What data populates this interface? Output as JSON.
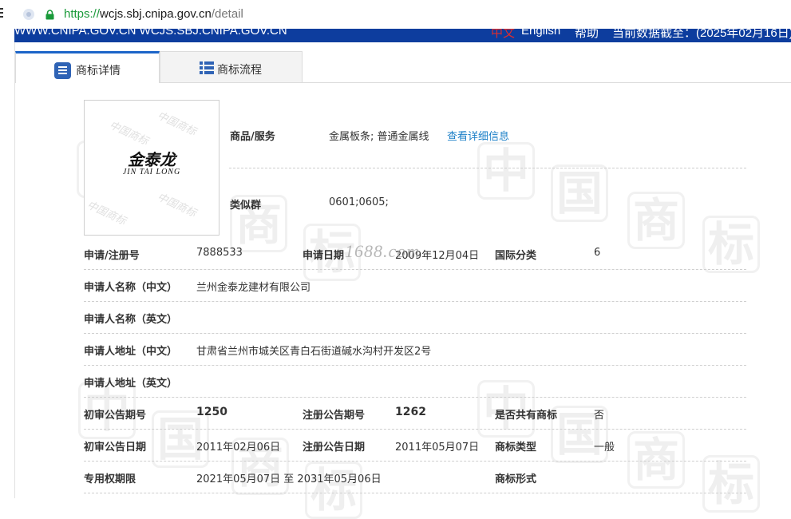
{
  "browser": {
    "url_scheme": "https://",
    "url_host": "wcjs.sbj.cnipa.gov.cn",
    "url_path": "/detail"
  },
  "sitebar": {
    "domains": "WWW.CNIPA.GOV.CN WCJS.SBJ.CNIPA.GOV.CN",
    "lang_zh": "中文",
    "lang_en": "English",
    "help": "帮助",
    "data_date": "当前数据截至：(2025年02月16日)"
  },
  "tabs": {
    "detail": "商标详情",
    "flow": "商标流程"
  },
  "logo": {
    "name_cn": "金泰龙",
    "name_en": "JIN TAI LONG"
  },
  "stamp_text": "1688.com",
  "detail": {
    "goods_label": "商品/服务",
    "goods_value": "金属板条; 普通金属线",
    "goods_link": "查看详细信息",
    "group_label": "类似群",
    "group_value": "0601;0605;",
    "reg_no_label": "申请/注册号",
    "reg_no_value": "7888533",
    "apply_date_label": "申请日期",
    "apply_date_value": "2009年12月04日",
    "intl_class_label": "国际分类",
    "intl_class_value": "6",
    "applicant_cn_label": "申请人名称（中文）",
    "applicant_cn_value": "兰州金泰龙建材有限公司",
    "applicant_en_label": "申请人名称（英文）",
    "address_cn_label": "申请人地址（中文）",
    "address_cn_value": "甘肃省兰州市城关区青白石街道碱水沟村开发区2号",
    "address_en_label": "申请人地址（英文）",
    "prelim_no_label": "初审公告期号",
    "prelim_no_value": "1250",
    "reg_ann_no_label": "注册公告期号",
    "reg_ann_no_value": "1262",
    "shared_label": "是否共有商标",
    "shared_value": "否",
    "prelim_date_label": "初审公告日期",
    "prelim_date_value": "2011年02月06日",
    "reg_ann_date_label": "注册公告日期",
    "reg_ann_date_value": "2011年05月07日",
    "tm_type_label": "商标类型",
    "tm_type_value": "一般",
    "exclusive_label": "专用权期限",
    "exclusive_value": "2021年05月07日 至 2031年05月06日",
    "tm_form_label": "商标形式"
  }
}
